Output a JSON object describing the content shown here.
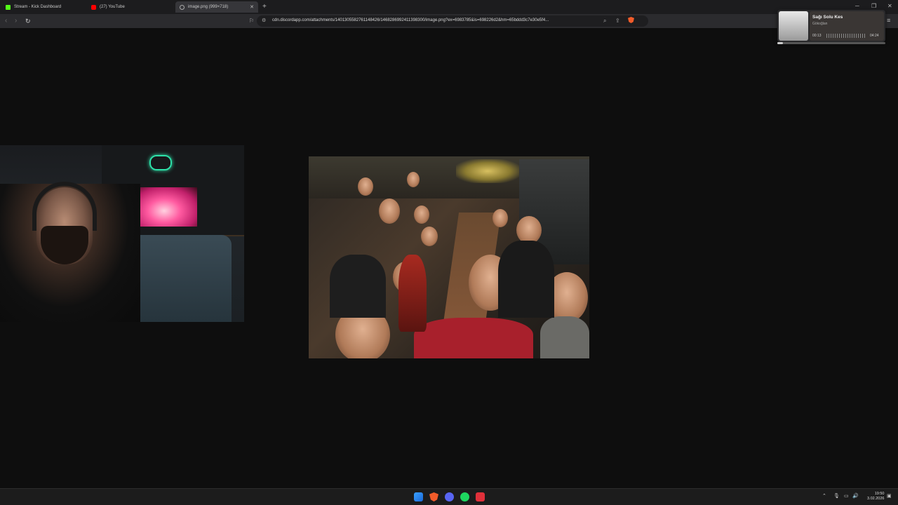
{
  "tabs": [
    {
      "label": "Stream - Kick Dashboard",
      "icon": "kick-icon",
      "color": "#53fc18"
    },
    {
      "label": "(27) YouTube",
      "icon": "youtube-icon",
      "color": "#ff0000"
    },
    {
      "label": "image.png (999×718)",
      "icon": "globe-icon",
      "color": "#888888",
      "active": true
    }
  ],
  "toolbar": {
    "url": "cdn.discordapp.com/attachments/1401305582761148426/1468286992411398300/image.png?ex=6983785&is=698226d2&hm=65bddd3c7e30e5f4..."
  },
  "media": {
    "title": "Sağı Solu Kes",
    "artist": "Gökoğlan",
    "elapsed": "00:13",
    "duration": "04:24",
    "progress": 0.05
  },
  "taskbar": {
    "time": "19:50",
    "date": "3.02.2026",
    "apps": [
      "windows-start-icon",
      "brave-icon",
      "discord-icon",
      "spotify-icon",
      "app-icon"
    ]
  }
}
